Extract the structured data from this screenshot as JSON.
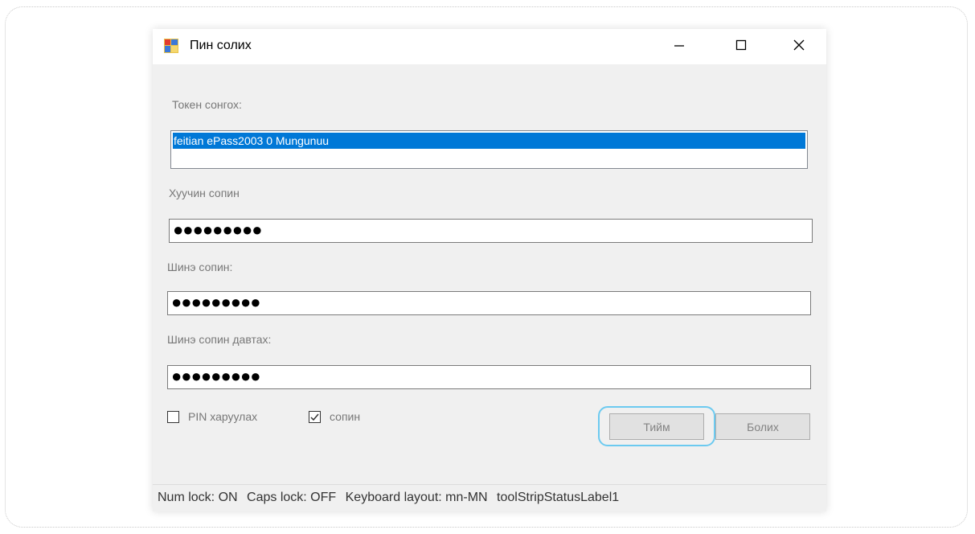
{
  "window": {
    "title": "Пин солих",
    "icon": "app-form-icon"
  },
  "controls": {
    "minimize_icon": "minimize-icon",
    "maximize_icon": "maximize-icon",
    "close_icon": "close-icon"
  },
  "form": {
    "token_label": "Токен сонгох:",
    "token_items": [
      "feitian ePass2003 0 Mungunuu"
    ],
    "old_pin_label": "Хуучин сопин",
    "old_pin_value": "●●●●●●●●●",
    "new_pin_label": "Шинэ сопин:",
    "new_pin_value": "●●●●●●●●●",
    "confirm_pin_label": "Шинэ сопин давтах:",
    "confirm_pin_value": "●●●●●●●●●",
    "show_pin_label": "PIN харуулах",
    "show_pin_checked": false,
    "sopin_label": "сопин",
    "sopin_checked": true,
    "ok_label": "Тийм",
    "cancel_label": "Болих"
  },
  "status": {
    "num_lock": "Num lock: ON",
    "caps_lock": "Caps lock: OFF",
    "keyboard_layout": "Keyboard layout: mn-MN",
    "label1": "toolStripStatusLabel1"
  },
  "colors": {
    "selection": "#0078d7",
    "highlight_ring": "#6ccaf0",
    "window_bg": "#f0f0f0"
  }
}
